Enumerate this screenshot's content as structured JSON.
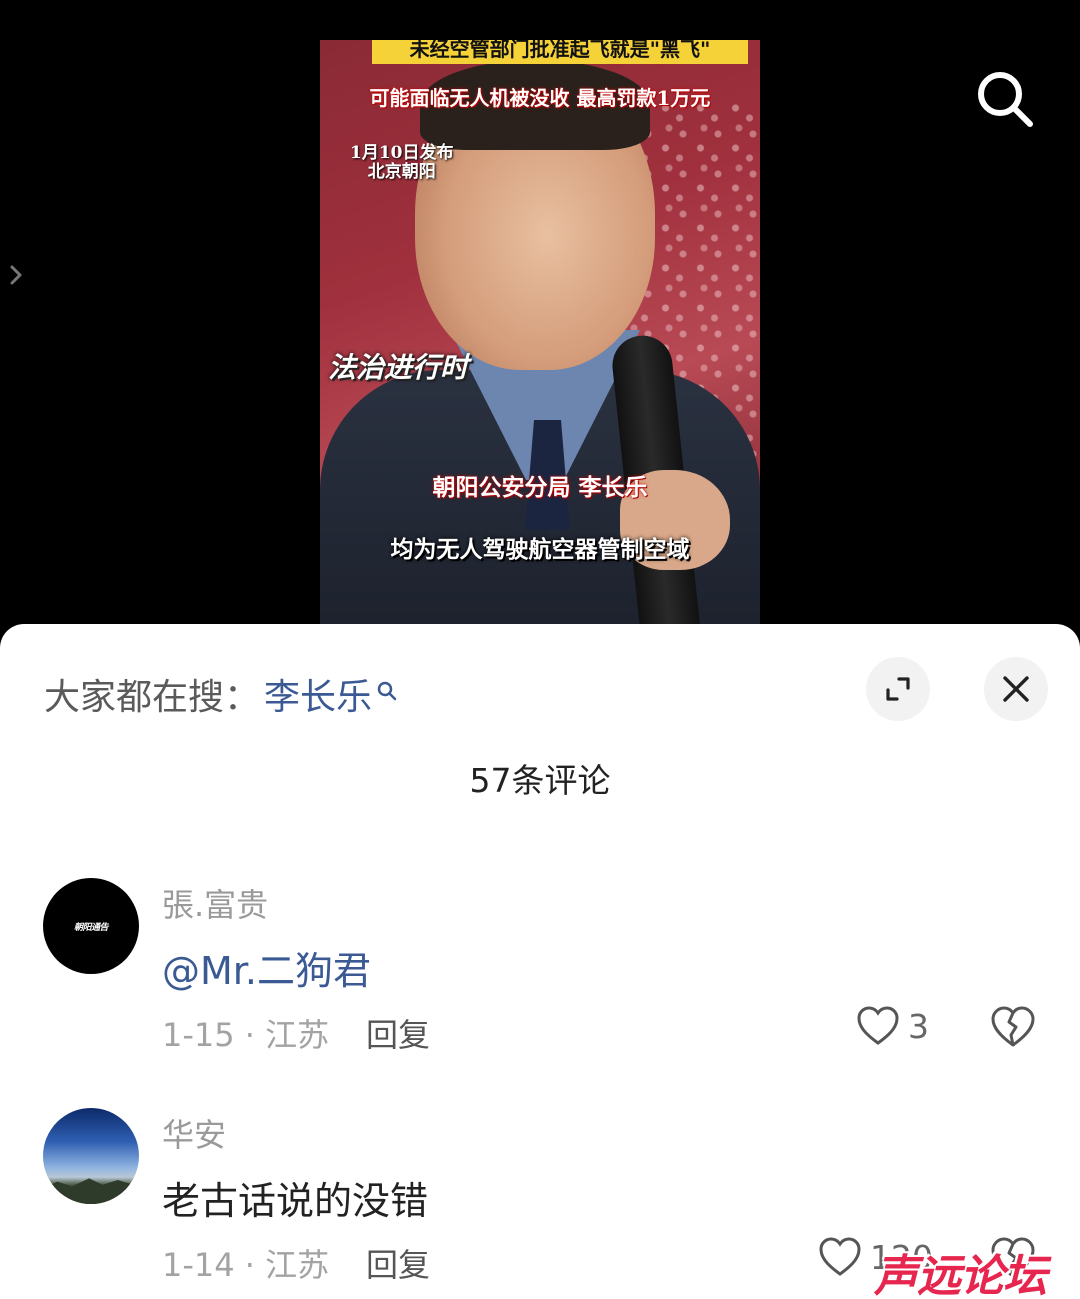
{
  "video": {
    "banner_text": "未经空管部门批准起飞就是\"黑飞\"",
    "subtitle_top": "可能面临无人机被没收 最高罚款1万元",
    "date_line1": "1月10日发布",
    "date_line2": "北京朝阳",
    "brand": "法治进行时",
    "speaker_name": "朝阳公安分局 李长乐",
    "caption": "均为无人驾驶航空器管制空域",
    "search_icon": "search-icon",
    "side_icon": "chevron-right-icon"
  },
  "sheet": {
    "search_label": "大家都在搜：",
    "search_keyword": "李长乐",
    "expand_icon": "expand-icon",
    "close_icon": "close-icon",
    "comment_count_label": "57条评论"
  },
  "comments": [
    {
      "avatar_text": "朝阳通告",
      "username": "張.富贵",
      "text": "@Mr.二狗君",
      "meta": "1-15 · 江苏",
      "reply_label": "回复",
      "likes": "3"
    },
    {
      "username": "华安",
      "text": "老古话说的没错",
      "meta": "1-14 · 江苏",
      "reply_label": "回复",
      "likes": "120"
    }
  ],
  "watermark": "声远论坛",
  "colors": {
    "link": "#3b5a94",
    "watermark": "#e6264f",
    "sheet_bg": "#ffffff",
    "video_bg": "#000000"
  }
}
